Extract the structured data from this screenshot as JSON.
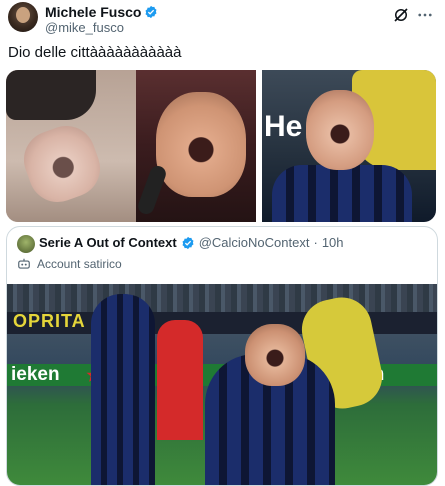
{
  "tweet": {
    "display_name": "Michele Fusco",
    "handle": "@mike_fusco",
    "text": "Dio delle cittààààààààààà",
    "verified": true
  },
  "quote": {
    "display_name": "Serie A Out of Context",
    "handle": "@CalcioNoContext",
    "separator": "·",
    "time": "10h",
    "label": "Account satirico",
    "verified": true
  },
  "images": {
    "right_banner_text": "He",
    "quote_banner_top": "OPRITA",
    "quote_banner_left": "ieken",
    "quote_banner_right": "eken"
  },
  "colors": {
    "verified_blue": "#1d9bf0",
    "text": "#0f1419",
    "muted": "#536471"
  },
  "icons": {
    "verified": "verified-badge-icon",
    "grok": "grok-icon",
    "more": "more-icon",
    "bot": "bot-icon"
  }
}
